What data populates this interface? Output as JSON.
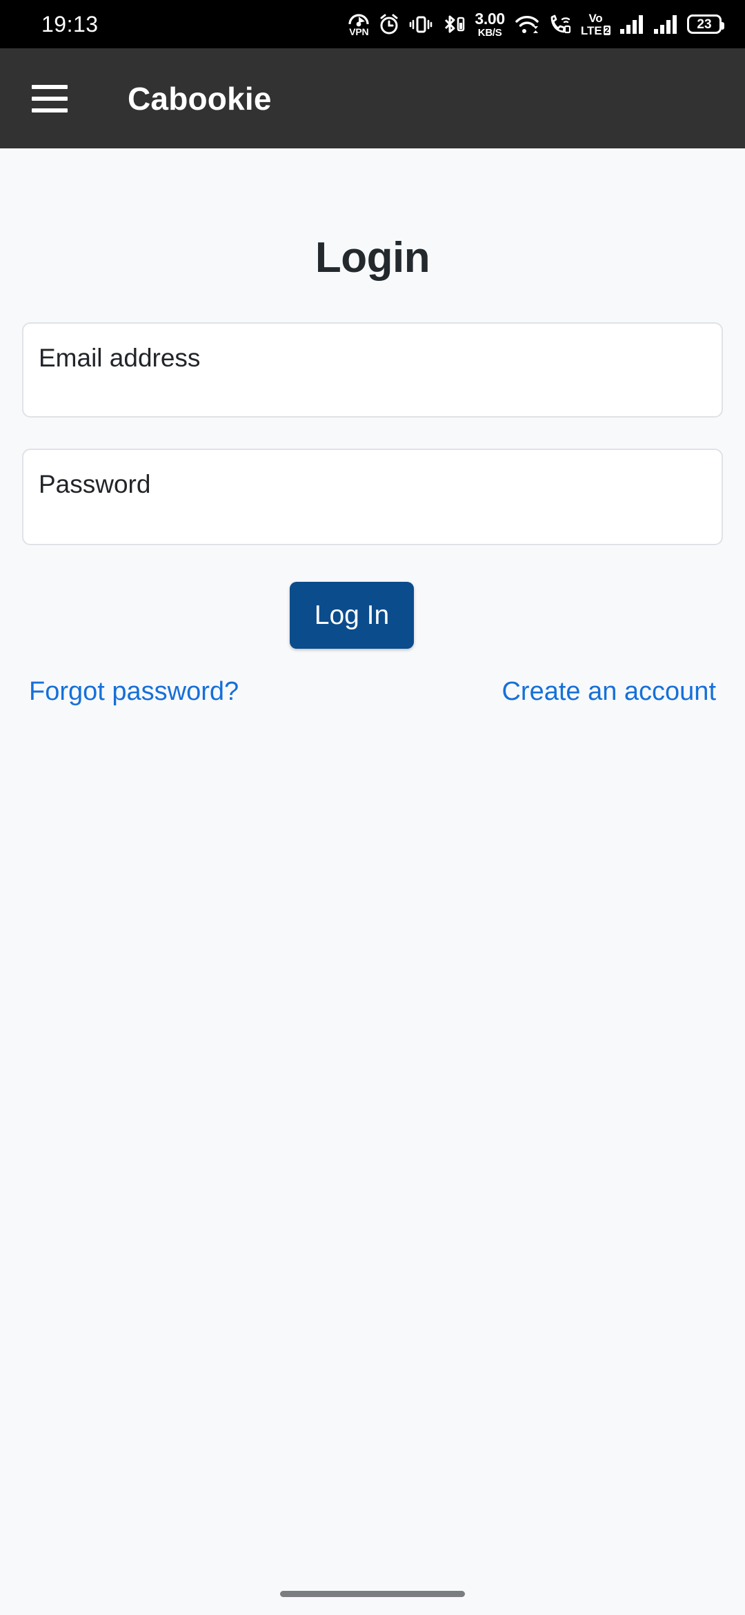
{
  "status_bar": {
    "clock": "19:13",
    "network_speed": {
      "value": "3.00",
      "unit": "KB/S"
    },
    "volte": {
      "line1": "Vo",
      "line2": "LTE",
      "sim": "2"
    },
    "vpn_label": "VPN",
    "battery_percent": "23",
    "icons": [
      "vpn-icon",
      "alarm-icon",
      "vibrate-icon",
      "bluetooth-icon",
      "network-speed-indicator",
      "wifi-icon",
      "wifi-calling-icon",
      "volte-icon",
      "signal-bars-sim1-icon",
      "signal-bars-sim2-icon",
      "battery-icon"
    ]
  },
  "app_bar": {
    "menu_icon": "hamburger-menu-icon",
    "title": "Cabookie",
    "background_color": "#323232",
    "title_color": "#ffffff"
  },
  "page": {
    "title": "Login",
    "background_color": "#f8f9fb",
    "title_color": "#24292d"
  },
  "form": {
    "email": {
      "label": "Email address",
      "value": "",
      "placeholder": "Email address"
    },
    "password": {
      "label": "Password",
      "value": "",
      "placeholder": "Password"
    },
    "submit": {
      "label": "Log In",
      "background_color": "#0b4c8c",
      "text_color": "#ffffff"
    }
  },
  "links": {
    "forgot_password": "Forgot password?",
    "create_account": "Create an account",
    "link_color": "#1570d9"
  },
  "system_nav": {
    "gesture_bar_color": "#7b7e80"
  }
}
